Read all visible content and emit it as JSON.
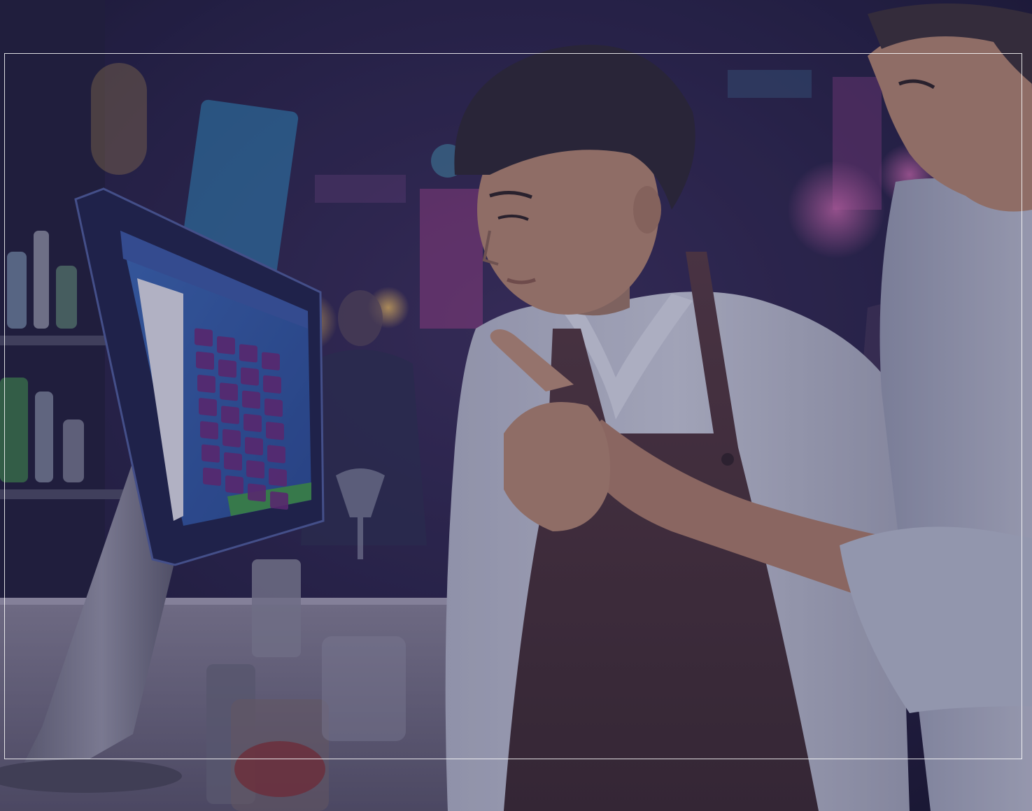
{
  "scene": {
    "description_colors": {
      "background_dark": "#1c1a3a",
      "neon_blue": "#3fa8d8",
      "neon_pink": "#c04a9a",
      "bokeh_warm": "#e0a040",
      "screen_blue": "#2e5ca8",
      "screen_purple": "#6a2a7a",
      "screen_green": "#3e9a4a",
      "shirt_white": "#c8ccd8",
      "apron_brown": "#4a3438",
      "skin": "#b88a70",
      "hair": "#2a2630",
      "overlay_tint": "#28245a"
    },
    "pos_grid": {
      "rows": 7,
      "cols": 4
    }
  }
}
